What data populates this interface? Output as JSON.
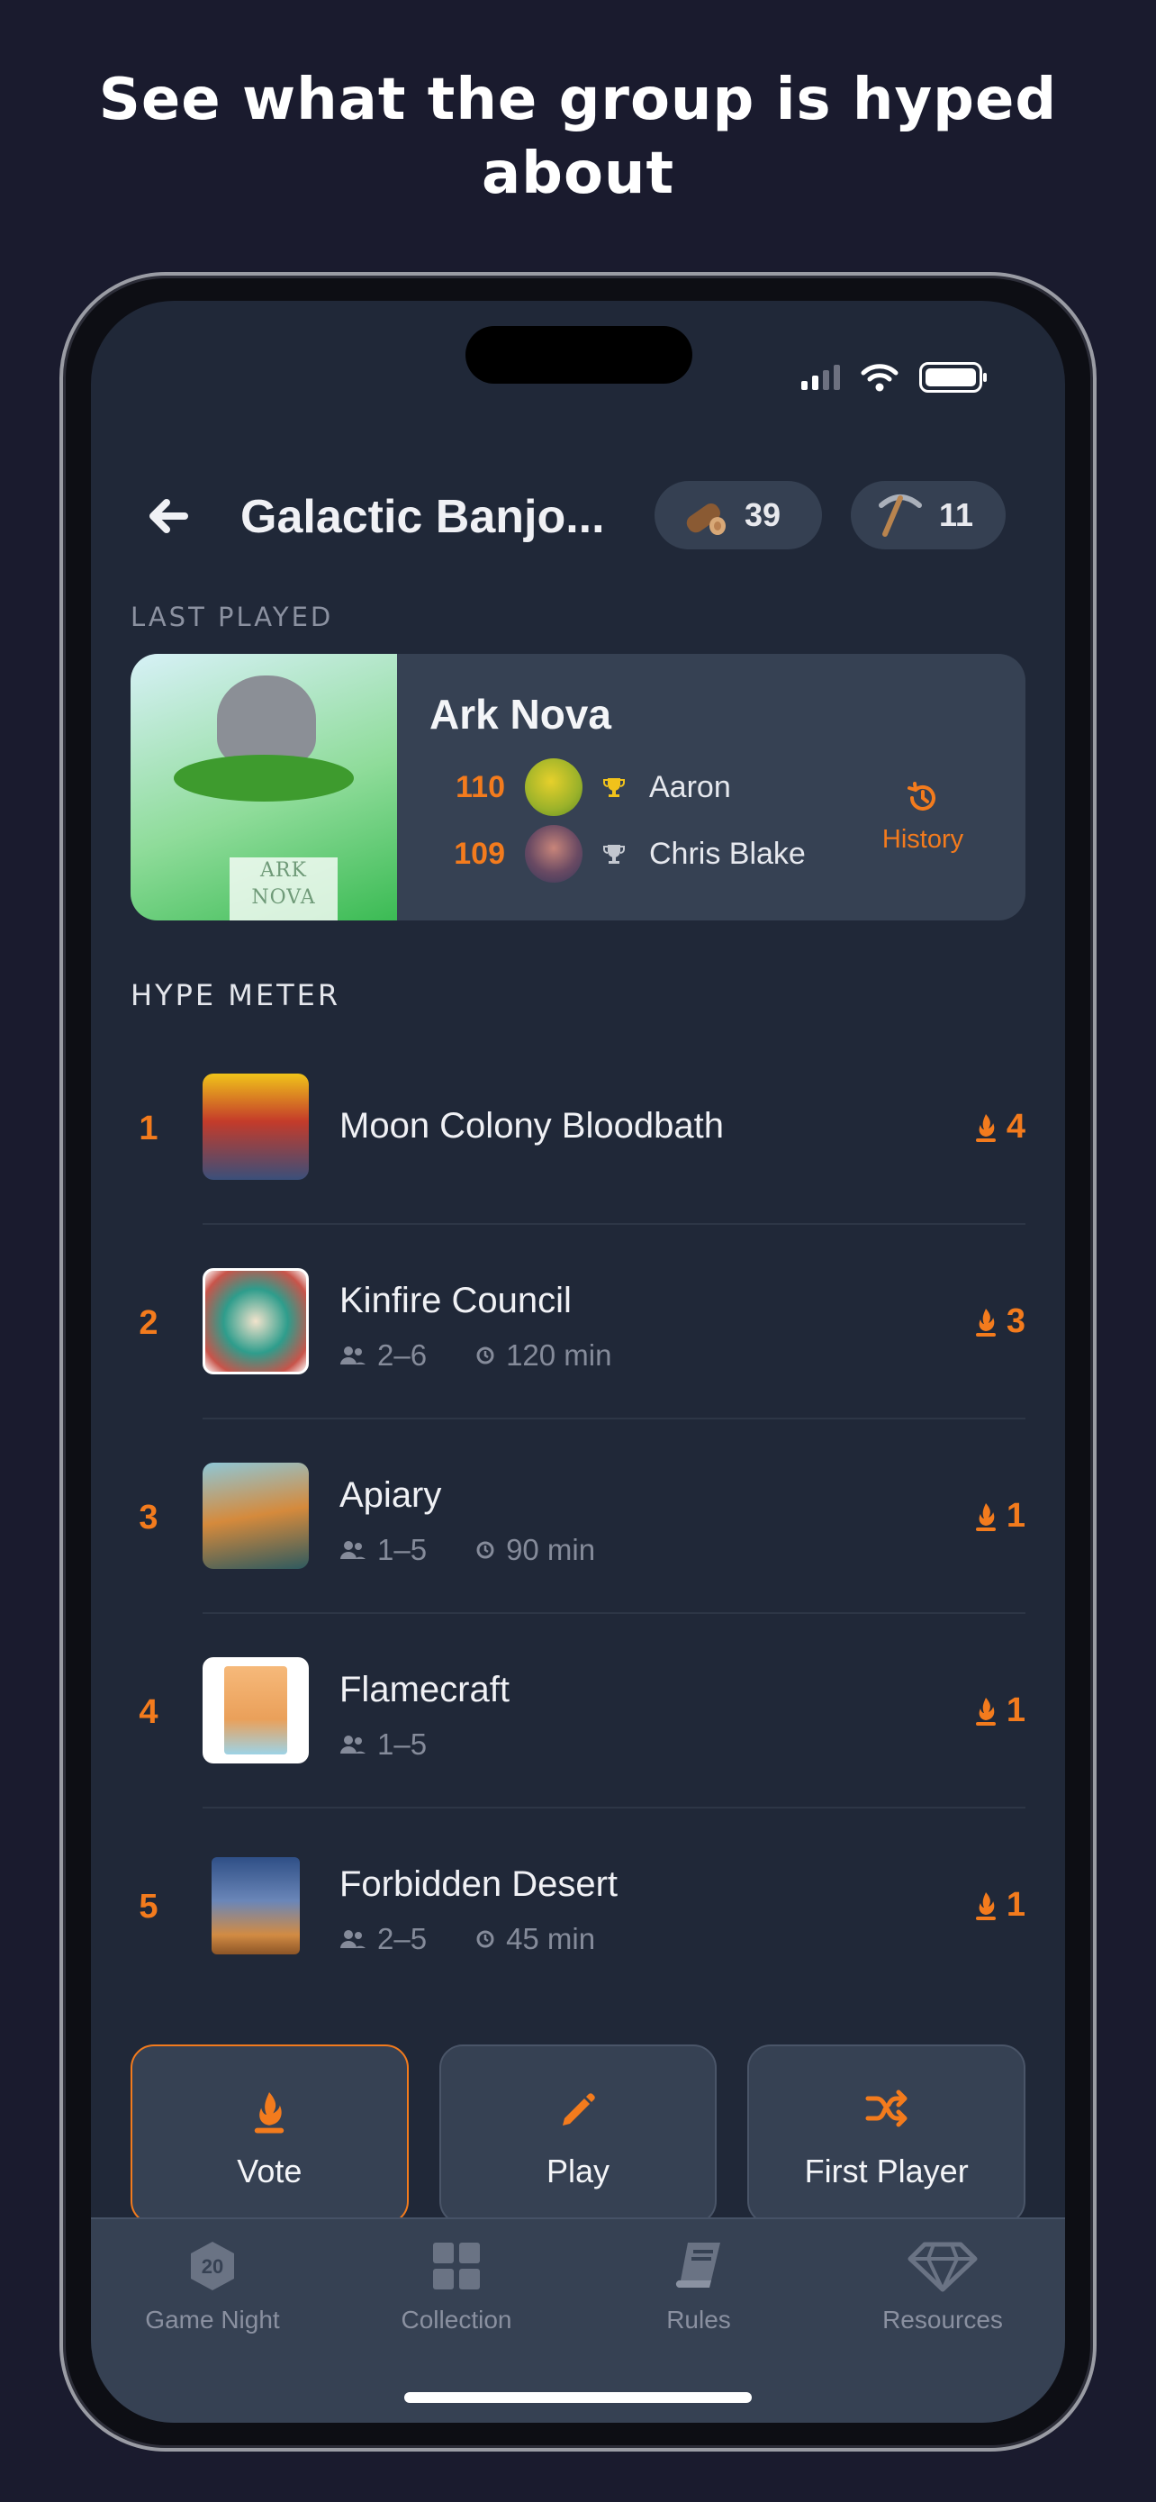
{
  "headline": "See what the group is hyped about",
  "header": {
    "group_name": "Galactic Banjo...",
    "wood_count": "39",
    "pick_count": "11"
  },
  "last_played": {
    "section_label": "LAST PLAYED",
    "game": "Ark Nova",
    "box_text_line1": "ARK",
    "box_text_line2": "NOVA",
    "players": [
      {
        "score": "110",
        "name": "Aaron",
        "trophy": "gold"
      },
      {
        "score": "109",
        "name": "Chris Blake",
        "trophy": "silver"
      }
    ],
    "history_label": "History"
  },
  "hype_meter": {
    "section_label": "HYPE METER",
    "items": [
      {
        "rank": "1",
        "name": "Moon Colony Bloodbath",
        "players": "",
        "time": "",
        "votes": "4"
      },
      {
        "rank": "2",
        "name": "Kinfire Council",
        "players": "2–6",
        "time": "120 min",
        "votes": "3"
      },
      {
        "rank": "3",
        "name": "Apiary",
        "players": "1–5",
        "time": "90 min",
        "votes": "1"
      },
      {
        "rank": "4",
        "name": "Flamecraft",
        "players": "1–5",
        "time": "",
        "votes": "1"
      },
      {
        "rank": "5",
        "name": "Forbidden Desert",
        "players": "2–5",
        "time": "45 min",
        "votes": "1"
      }
    ]
  },
  "actions": {
    "vote": "Vote",
    "play": "Play",
    "first_player": "First Player"
  },
  "tabs": [
    {
      "label": "Game Night",
      "badge": "20"
    },
    {
      "label": "Collection"
    },
    {
      "label": "Rules"
    },
    {
      "label": "Resources"
    }
  ],
  "colors": {
    "accent": "#f37b1d",
    "background": "#1a1b2e",
    "screen": "#202838",
    "card": "#364153"
  }
}
